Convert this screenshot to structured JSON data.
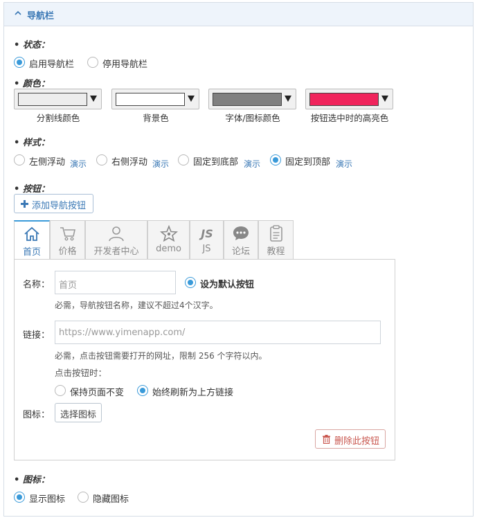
{
  "header": {
    "title": "导航栏"
  },
  "status": {
    "label": "状态：",
    "options": [
      "启用导航栏",
      "停用导航栏"
    ],
    "selected": 0
  },
  "colors": {
    "label": "颜色：",
    "pickers": [
      {
        "caption": "分割线颜色",
        "value": "#ededed"
      },
      {
        "caption": "背景色",
        "value": "#ffffff"
      },
      {
        "caption": "字体/图标颜色",
        "value": "#808080"
      },
      {
        "caption": "按钮选中时的高亮色",
        "value": "#f0245c"
      }
    ]
  },
  "style": {
    "label": "样式：",
    "options": [
      "左侧浮动",
      "右侧浮动",
      "固定到底部",
      "固定到顶部"
    ],
    "demo": "演示",
    "selected": 3
  },
  "buttons": {
    "label": "按钮：",
    "add_label": "添加导航按钮",
    "tabs": [
      {
        "label": "首页",
        "icon": "home-icon"
      },
      {
        "label": "价格",
        "icon": "cart-icon"
      },
      {
        "label": "开发者中心",
        "icon": "user-icon"
      },
      {
        "label": "demo",
        "icon": "star-icon"
      },
      {
        "label": "JS",
        "icon": "js-icon"
      },
      {
        "label": "论坛",
        "icon": "chat-icon"
      },
      {
        "label": "教程",
        "icon": "clipboard-icon"
      }
    ],
    "active_tab": 0,
    "form": {
      "name_label": "名称：",
      "name_value": "首页",
      "default_label": "设为默认按钮",
      "name_hint": "必需，导航按钮名称，建议不超过4个汉字。",
      "link_label": "链接：",
      "link_placeholder": "https://www.yimenapp.com/",
      "link_hint": "必需，点击按钮需要打开的网址，限制 256 个字符以内。",
      "click_label": "点击按钮时：",
      "click_options": [
        "保持页面不变",
        "始终刷新为上方链接"
      ],
      "click_selected": 1,
      "icon_label": "图标：",
      "choose_icon_label": "选择图标",
      "delete_label": "删除此按钮"
    }
  },
  "icons": {
    "label": "图标：",
    "options": [
      "显示图标",
      "隐藏图标"
    ],
    "selected": 0
  },
  "theme": {
    "accent": "#3a9ad9",
    "link": "#3a78b5",
    "danger": "#c9574f"
  }
}
